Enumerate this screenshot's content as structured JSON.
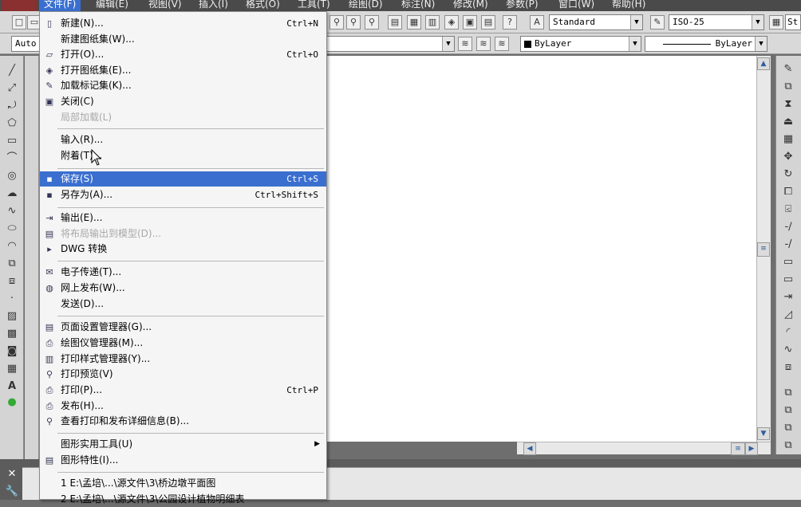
{
  "menubar": {
    "items": [
      "文件(F)",
      "编辑(E)",
      "视图(V)",
      "插入(I)",
      "格式(O)",
      "工具(T)",
      "绘图(D)",
      "标注(N)",
      "修改(M)",
      "参数(P)",
      "窗口(W)",
      "帮助(H)"
    ]
  },
  "toolbar": {
    "text_style": "Standard",
    "dim_style": "ISO-25",
    "extra": "St",
    "workspace": "Auto",
    "color": "ByLayer",
    "linetype": "ByLayer"
  },
  "filemenu": {
    "items": [
      {
        "label": "新建(N)...",
        "shortcut": "Ctrl+N",
        "icon": "new-icon"
      },
      {
        "label": "新建图纸集(W)...",
        "shortcut": "",
        "icon": ""
      },
      {
        "label": "打开(O)...",
        "shortcut": "Ctrl+O",
        "icon": "open-icon"
      },
      {
        "label": "打开图纸集(E)...",
        "shortcut": "",
        "icon": "open-sheetset-icon"
      },
      {
        "label": "加载标记集(K)...",
        "shortcut": "",
        "icon": "markup-icon"
      },
      {
        "label": "关闭(C)",
        "shortcut": "",
        "icon": "close-icon"
      },
      {
        "label": "局部加载(L)",
        "shortcut": "",
        "icon": ""
      },
      {
        "label": "输入(R)...",
        "shortcut": "",
        "icon": ""
      },
      {
        "label": "附着(T)...",
        "shortcut": "",
        "icon": ""
      },
      {
        "label": "保存(S)",
        "shortcut": "Ctrl+S",
        "icon": "save-icon"
      },
      {
        "label": "另存为(A)...",
        "shortcut": "Ctrl+Shift+S",
        "icon": "saveas-icon"
      },
      {
        "label": "输出(E)...",
        "shortcut": "",
        "icon": "export-icon"
      },
      {
        "label": "将布局输出到模型(D)...",
        "shortcut": "",
        "icon": "layout-export-icon"
      },
      {
        "label": "DWG 转换",
        "shortcut": "",
        "icon": "dwg-convert-icon"
      },
      {
        "label": "电子传递(T)...",
        "shortcut": "",
        "icon": "etransmit-icon"
      },
      {
        "label": "网上发布(W)...",
        "shortcut": "",
        "icon": "publish-web-icon"
      },
      {
        "label": "发送(D)...",
        "shortcut": "",
        "icon": ""
      },
      {
        "label": "页面设置管理器(G)...",
        "shortcut": "",
        "icon": "page-setup-icon"
      },
      {
        "label": "绘图仪管理器(M)...",
        "shortcut": "",
        "icon": "plotter-icon"
      },
      {
        "label": "打印样式管理器(Y)...",
        "shortcut": "",
        "icon": "plot-style-icon"
      },
      {
        "label": "打印预览(V)",
        "shortcut": "",
        "icon": "preview-icon"
      },
      {
        "label": "打印(P)...",
        "shortcut": "Ctrl+P",
        "icon": "print-icon"
      },
      {
        "label": "发布(H)...",
        "shortcut": "",
        "icon": "publish-icon"
      },
      {
        "label": "查看打印和发布详细信息(B)...",
        "shortcut": "",
        "icon": "plot-details-icon"
      },
      {
        "label": "图形实用工具(U)",
        "shortcut": "",
        "icon": ""
      },
      {
        "label": "图形特性(I)...",
        "shortcut": "",
        "icon": "properties-icon"
      },
      {
        "label": "1 E:\\孟培\\...\\源文件\\3\\桥边墩平面图",
        "shortcut": "",
        "icon": ""
      },
      {
        "label": "2 E:\\孟培\\...\\源文件\\3\\公园设计植物明细表",
        "shortcut": "",
        "icon": ""
      }
    ]
  }
}
